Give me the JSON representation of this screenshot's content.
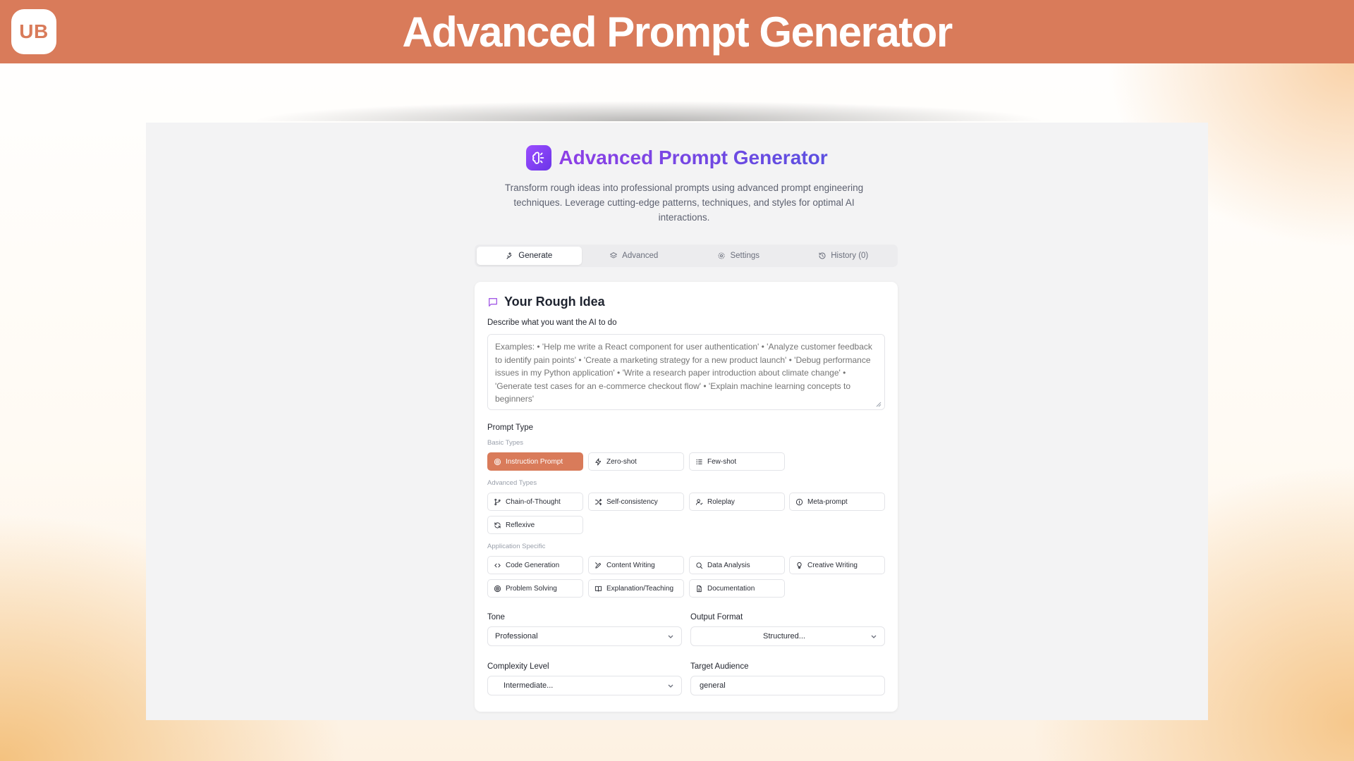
{
  "banner": {
    "logo_text": "UB",
    "title": "Advanced Prompt Generator"
  },
  "app": {
    "title": "Advanced Prompt Generator",
    "description": "Transform rough ideas into professional prompts using advanced prompt engineering techniques. Leverage cutting-edge patterns, techniques, and styles for optimal AI interactions.",
    "accent_color": "#7a3fe0",
    "selected_chip_color": "#d97b5a"
  },
  "tabs": [
    {
      "label": "Generate",
      "icon": "sparkles-icon",
      "active": true
    },
    {
      "label": "Advanced",
      "icon": "layers-icon",
      "active": false
    },
    {
      "label": "Settings",
      "icon": "gear-icon",
      "active": false
    },
    {
      "label": "History (0)",
      "icon": "history-icon",
      "active": false
    }
  ],
  "idea": {
    "title": "Your Rough Idea",
    "field_label": "Describe what you want the AI to do",
    "placeholder": "Examples: • 'Help me write a React component for user authentication' • 'Analyze customer feedback to identify pain points' • 'Create a marketing strategy for a new product launch' • 'Debug performance issues in my Python application' • 'Write a research paper introduction about climate change' • 'Generate test cases for an e-commerce checkout flow' • 'Explain machine learning concepts to beginners'"
  },
  "prompt_type": {
    "label": "Prompt Type",
    "basic_label": "Basic Types",
    "basic": [
      {
        "label": "Instruction Prompt",
        "icon": "target-icon",
        "selected": true
      },
      {
        "label": "Zero-shot",
        "icon": "zap-icon",
        "selected": false
      },
      {
        "label": "Few-shot",
        "icon": "list-icon",
        "selected": false
      }
    ],
    "advanced_label": "Advanced Types",
    "advanced": [
      {
        "label": "Chain-of-Thought",
        "icon": "git-branch-icon"
      },
      {
        "label": "Self-consistency",
        "icon": "shuffle-icon"
      },
      {
        "label": "Roleplay",
        "icon": "user-icon"
      },
      {
        "label": "Meta-prompt",
        "icon": "info-icon"
      },
      {
        "label": "Reflexive",
        "icon": "refresh-icon"
      }
    ],
    "application_label": "Application Specific",
    "application": [
      {
        "label": "Code Generation",
        "icon": "code-icon"
      },
      {
        "label": "Content Writing",
        "icon": "pen-icon"
      },
      {
        "label": "Data Analysis",
        "icon": "search-icon"
      },
      {
        "label": "Creative Writing",
        "icon": "lightbulb-icon"
      },
      {
        "label": "Problem Solving",
        "icon": "target-icon"
      },
      {
        "label": "Explanation/Teaching",
        "icon": "book-icon"
      },
      {
        "label": "Documentation",
        "icon": "file-icon"
      }
    ]
  },
  "tone": {
    "label": "Tone",
    "value": "Professional"
  },
  "output_format": {
    "label": "Output Format",
    "value": "Structured..."
  },
  "complexity": {
    "label": "Complexity Level",
    "value": "Intermediate..."
  },
  "audience": {
    "label": "Target Audience",
    "value": "general"
  }
}
